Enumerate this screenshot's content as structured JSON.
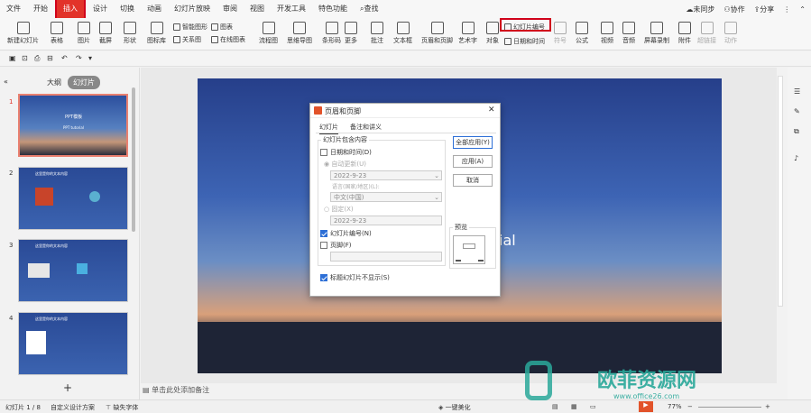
{
  "menubar": {
    "items": [
      "文件",
      "开始",
      "插入",
      "设计",
      "切换",
      "动画",
      "幻灯片放映",
      "审阅",
      "视图",
      "开发工具",
      "特色功能"
    ],
    "search": "查找",
    "right": [
      "未同步",
      "协作",
      "分享"
    ]
  },
  "ribbon": {
    "new_slide": "新建幻灯片",
    "table": "表格",
    "picture": "图片",
    "screenshot": "截屏",
    "shape": "形状",
    "icon_lib": "图标库",
    "smart_graphic": "智能图形",
    "chart": "图表",
    "relation": "关系图",
    "online_chart": "在线图表",
    "flowchart": "流程图",
    "mindmap": "思维导图",
    "barcode": "条形码",
    "more": "更多",
    "comment": "批注",
    "textbox": "文本框",
    "header_footer": "页眉和页脚",
    "wordart": "艺术字",
    "object": "对象",
    "slide_number": "幻灯片编号",
    "date_time": "日期和时间",
    "symbol": "符号",
    "formula": "公式",
    "video": "视频",
    "audio": "音频",
    "screen_record": "屏幕录制",
    "attachment": "附件",
    "hyperlink": "超链接",
    "action": "动作"
  },
  "leftpanel": {
    "tab_outline": "大纲",
    "tab_slides": "幻灯片",
    "slides": [
      {
        "num": "1",
        "title": "PPT模板",
        "subtitle": "PPT tutorial"
      },
      {
        "num": "2",
        "title": "这里是你的文本内容"
      },
      {
        "num": "3",
        "title": "这里是你的文本内容"
      },
      {
        "num": "4",
        "title": "这里是你的文本内容"
      }
    ]
  },
  "slide_text": "ial",
  "notes_placeholder": "单击此处添加备注",
  "dialog": {
    "title": "页眉和页脚",
    "tabs": [
      "幻灯片",
      "备注和讲义"
    ],
    "group_label": "幻灯片包含内容",
    "date_time_label": "日期和时间(D)",
    "auto_update_label": "自动更新(U)",
    "auto_date": "2022-9-23",
    "language_label": "语言(国家/地区)(L):",
    "language_value": "中文(中国)",
    "fixed_label": "固定(X)",
    "fixed_date": "2022-9-23",
    "slide_number_label": "幻灯片编号(N)",
    "footer_label": "页脚(F)",
    "title_slide_label": "标题幻灯片不显示(S)",
    "preview_label": "预览",
    "btn_apply_all": "全部应用(Y)",
    "btn_apply": "应用(A)",
    "btn_cancel": "取消"
  },
  "statusbar": {
    "slide_pos": "幻灯片 1 / 8",
    "design": "自定义设计方案",
    "font_missing": "缺失字体",
    "beautify": "一键美化",
    "zoom": "77%"
  },
  "watermark": {
    "brand": "欧菲资源网",
    "url": "www.office26.com"
  },
  "colors": {
    "accent": "#d0021b",
    "check": "#2d6fd6",
    "watermark": "#2aa89a"
  }
}
